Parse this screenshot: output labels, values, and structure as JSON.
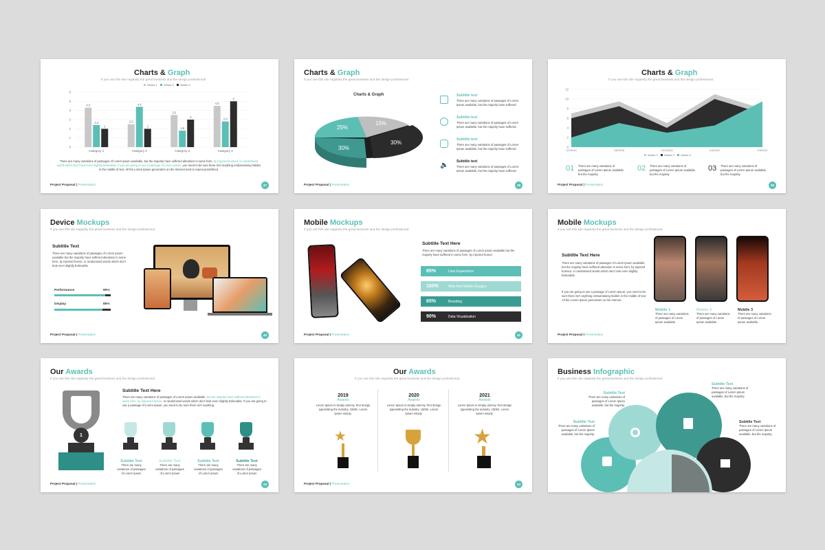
{
  "footer": {
    "brand": "Project Proposal |",
    "brand2": "Presentation"
  },
  "subtitle_common": "If you use this site regularly the great business and the design professional.",
  "slides": {
    "s1": {
      "title_a": "Charts & ",
      "title_b": "Graph",
      "page": "37",
      "body1": "There are many variations of passages of Lorem Ipsum available, but the majority have suffered alteration in some form,",
      "body1b": " by injected humour, or randomised",
      "body2": "words which don't look even slightly believable. If you are going to use a passage of Lorem Ipsum,",
      "body2b": " you need to be sure there isn't anything embarrassing hidden in the",
      "body3": "middle of text. All the Lorem Ipsum generators on the Internet tend to repeat predefined."
    },
    "s2": {
      "title_a": "Charts & ",
      "title_b": "Graph",
      "page": "38",
      "chart_title": "Charts & Graph",
      "items": [
        {
          "title": "Subtitle text",
          "text": "There are many variations of passages of Lorem Ipsum available, but the majority have suffered."
        },
        {
          "title": "Subtitle text",
          "text": "There are many variations of passages of Lorem Ipsum available, but the majority have suffered."
        },
        {
          "title": "Subtitle text",
          "text": "There are many variations of passages of Lorem Ipsum available, but the majority have suffered."
        },
        {
          "title": "Subtitle text",
          "text": "There are many variations of passages of Lorem Ipsum available, but the majority have suffered."
        }
      ]
    },
    "s3": {
      "title_a": "Charts & ",
      "title_b": "Graph",
      "page": "39",
      "nums": [
        {
          "n": "01",
          "text": "There are many variations of passages of Lorem Ipsum available, but the majority."
        },
        {
          "n": "02",
          "text": "There are many variations of passages of Lorem Ipsum available, but the majority."
        },
        {
          "n": "03",
          "text": "There are many variations of passages of Lorem Ipsum available, but the majority."
        }
      ]
    },
    "s4": {
      "title_a": "Device ",
      "title_b": "Mockups",
      "page": "40",
      "sub_title": "Subtitle Text",
      "body": "There are many variations of passages of Lorem Ipsum available but the majority have suffered alteration in some form, by injected humor, or randomized words which don't look even slightly believable.",
      "p1_label": "Performance",
      "p1_pct": "90%",
      "p2_label": "Display",
      "p2_pct": "85%"
    },
    "s5": {
      "title_a": "Mobile ",
      "title_b": "Mockups",
      "page": "41",
      "sub_title": "Subtitle Text Here",
      "body": "There are many variations of passages of Lorem Ipsum available but the majority have suffered in some form, by injected humor.",
      "ribbons": [
        {
          "pct": "85%",
          "label": "User Experience"
        },
        {
          "pct": "100%",
          "label": "Web And Mobile Designs"
        },
        {
          "pct": "65%",
          "label": "Branding"
        },
        {
          "pct": "90%",
          "label": "Data Visualization"
        }
      ]
    },
    "s6": {
      "title_a": "Mobile ",
      "title_b": "Mockups",
      "page": "",
      "sub_title": "Subtitle Text Here",
      "body1": "There are many variations of passages of Lorem Ipsum available, but the majority have suffered alteration in some form, by injected humour, or randomised words which don't look even slightly believable.",
      "body2": "If you are going to use a passage of Lorem Ipsum, you need to be sure there isn't anything embarrassing hidden in the middle of text. All the Lorem Ipsum generators on the Internet.",
      "mobiles": [
        {
          "label": "Mobile 1",
          "text": "There are many variations of passages of Lorem Ipsum available."
        },
        {
          "label": "Mobile 2",
          "text": "There are many variations of passages of Lorem Ipsum available."
        },
        {
          "label": "Mobile 3",
          "text": "There are many variations of passages of Lorem Ipsum available."
        }
      ]
    },
    "s7": {
      "title_a": "Our ",
      "title_b": "Awards",
      "page": "43",
      "sub_title": "Subtitle Text Here",
      "body_a": "There are many variations of passages of Lorem Ipsum available,",
      "body_b": " but the majority have suffered alteration in some form, by injected humour,",
      "body_c": " or randomised words which don't look even slightly believable. If you are going to use a passage of Lorem Ipsum, you need to be sure there isn't anything.",
      "trophy_num": "1",
      "items": [
        {
          "title": "Subtitle Text",
          "text": "There are many variations of passages of Lorem Ipsum"
        },
        {
          "title": "Subtitle Text",
          "text": "There are many variations of passages of Lorem Ipsum"
        },
        {
          "title": "Subtitle Text",
          "text": "There are many variations of passages of Lorem Ipsum"
        },
        {
          "title": "Subtitle Text",
          "text": "There are many variations of passages of Lorem Ipsum"
        }
      ]
    },
    "s8": {
      "title_a": "Our ",
      "title_b": "Awards",
      "page": "44",
      "cols": [
        {
          "year": "2019",
          "label": "Awards",
          "text": "Lorem Ipsum is simply dummy Text design typesetting the industry. 1500s. Lorem Ipsum simply."
        },
        {
          "year": "2020",
          "label": "Awards",
          "text": "Lorem Ipsum is simply dummy Text design typesetting the industry. 1500s. Lorem Ipsum simply."
        },
        {
          "year": "2021",
          "label": "Awards",
          "text": "Lorem Ipsum is simply dummy Text design typesetting the industry. 1500s. Lorem Ipsum simply."
        }
      ]
    },
    "s9": {
      "title_a": "Business ",
      "title_b": "Infographic",
      "page": "",
      "items": [
        {
          "title": "Subtitle Text",
          "text": "There are many variations of passages of Lorem Ipsum available, but the majority."
        },
        {
          "title": "Subtitle Text",
          "text": "There are many variations of passages of Lorem Ipsum available, but the majority."
        },
        {
          "title": "Subtitle Text",
          "text": "There are many variations of passages of Lorem Ipsum available, but the majority."
        },
        {
          "title": "Subtitle Text",
          "text": "There are many variations of passages of Lorem Ipsum available, but the majority."
        }
      ]
    }
  },
  "colors": {
    "accent": "#5cbfb6",
    "dark": "#333333",
    "grey": "#c8c8c8"
  },
  "chart_data": [
    {
      "type": "bar",
      "categories": [
        "Category 1",
        "Category 2",
        "Category 3",
        "Category 4"
      ],
      "series": [
        {
          "name": "Series 1",
          "values": [
            4.3,
            2.5,
            3.5,
            4.5
          ]
        },
        {
          "name": "Series 2",
          "values": [
            2.4,
            4.4,
            1.8,
            2.8
          ]
        },
        {
          "name": "Series 3",
          "values": [
            2,
            2,
            3,
            5
          ]
        }
      ],
      "ylim": [
        0,
        6
      ],
      "yticks": [
        "0",
        "1",
        "2",
        "3",
        "4",
        "5",
        "6"
      ],
      "legend": "top"
    },
    {
      "type": "pie",
      "title": "Charts & Graph",
      "labels": [
        "25%",
        "15%",
        "30%",
        "30%"
      ],
      "values": [
        25,
        15,
        30,
        30
      ]
    },
    {
      "type": "area",
      "x": [
        "1/1/2010",
        "1/6/2010",
        "1/11/2010",
        "1/4/2011",
        "1/9/2011"
      ],
      "series": [
        {
          "name": "Series 1",
          "values": [
            7,
            9.5,
            5,
            11,
            8
          ]
        },
        {
          "name": "Series 2",
          "values": [
            6,
            8.5,
            4,
            10,
            7
          ]
        },
        {
          "name": "Series 3",
          "values": [
            2,
            5,
            3,
            4.5,
            9.5
          ]
        }
      ],
      "ylim": [
        0,
        12
      ],
      "yticks": [
        "0",
        "2",
        "4",
        "6",
        "8",
        "10",
        "12"
      ],
      "legend": "bottom"
    }
  ]
}
